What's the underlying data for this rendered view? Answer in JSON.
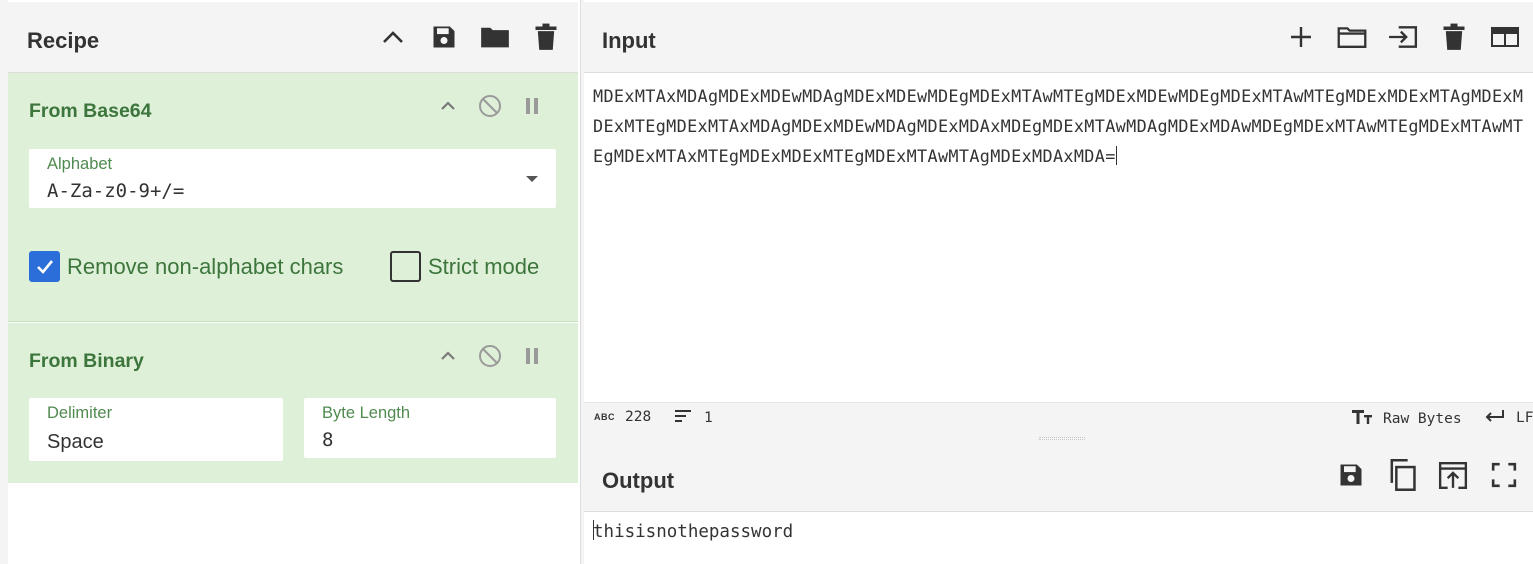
{
  "recipe": {
    "title": "Recipe",
    "icons": [
      "chevron-up-icon",
      "save-icon",
      "folder-icon",
      "trash-icon"
    ]
  },
  "operations": [
    {
      "name": "From Base64",
      "alphabet_label": "Alphabet",
      "alphabet_value": "A-Za-z0-9+/=",
      "remove_non_alphabet_label": "Remove non-alphabet chars",
      "remove_non_alphabet_checked": true,
      "strict_mode_label": "Strict mode",
      "strict_mode_checked": false
    },
    {
      "name": "From Binary",
      "delimiter_label": "Delimiter",
      "delimiter_value": "Space",
      "byte_length_label": "Byte Length",
      "byte_length_value": "8"
    }
  ],
  "input": {
    "title": "Input",
    "text": "MDExMTAxMDAgMDExMDEwMDAgMDExMDEwMDEgMDExMTAwMTEgMDExMDEwMDEgMDExMTAwMTEgMDExMDExMTAgMDExMDExMTEgMDExMTAxMDAgMDExMDEwMDAgMDExMDAxMDEgMDExMTAwMDAgMDExMDAwMDEgMDExMTAwMTEgMDExMTAwMTEgMDExMTAxMTEgMDExMDExMTEgMDExMTAwMTAgMDExMDAxMDA=",
    "icons": [
      "plus-icon",
      "folder-icon",
      "import-icon",
      "trash-icon",
      "layout-icon"
    ]
  },
  "status": {
    "length": "228",
    "lines": "1",
    "encoding": "Raw Bytes",
    "eol": "LF"
  },
  "output": {
    "title": "Output",
    "text": "thisisnothepassword",
    "icons": [
      "save-icon",
      "copy-icon",
      "replace-input-icon",
      "fullscreen-icon"
    ]
  },
  "colors": {
    "op_bg": "#dff0d8",
    "op_text": "#3c763d",
    "checkbox_on": "#2b6ed9",
    "panel_bg": "#f4f4f4"
  }
}
